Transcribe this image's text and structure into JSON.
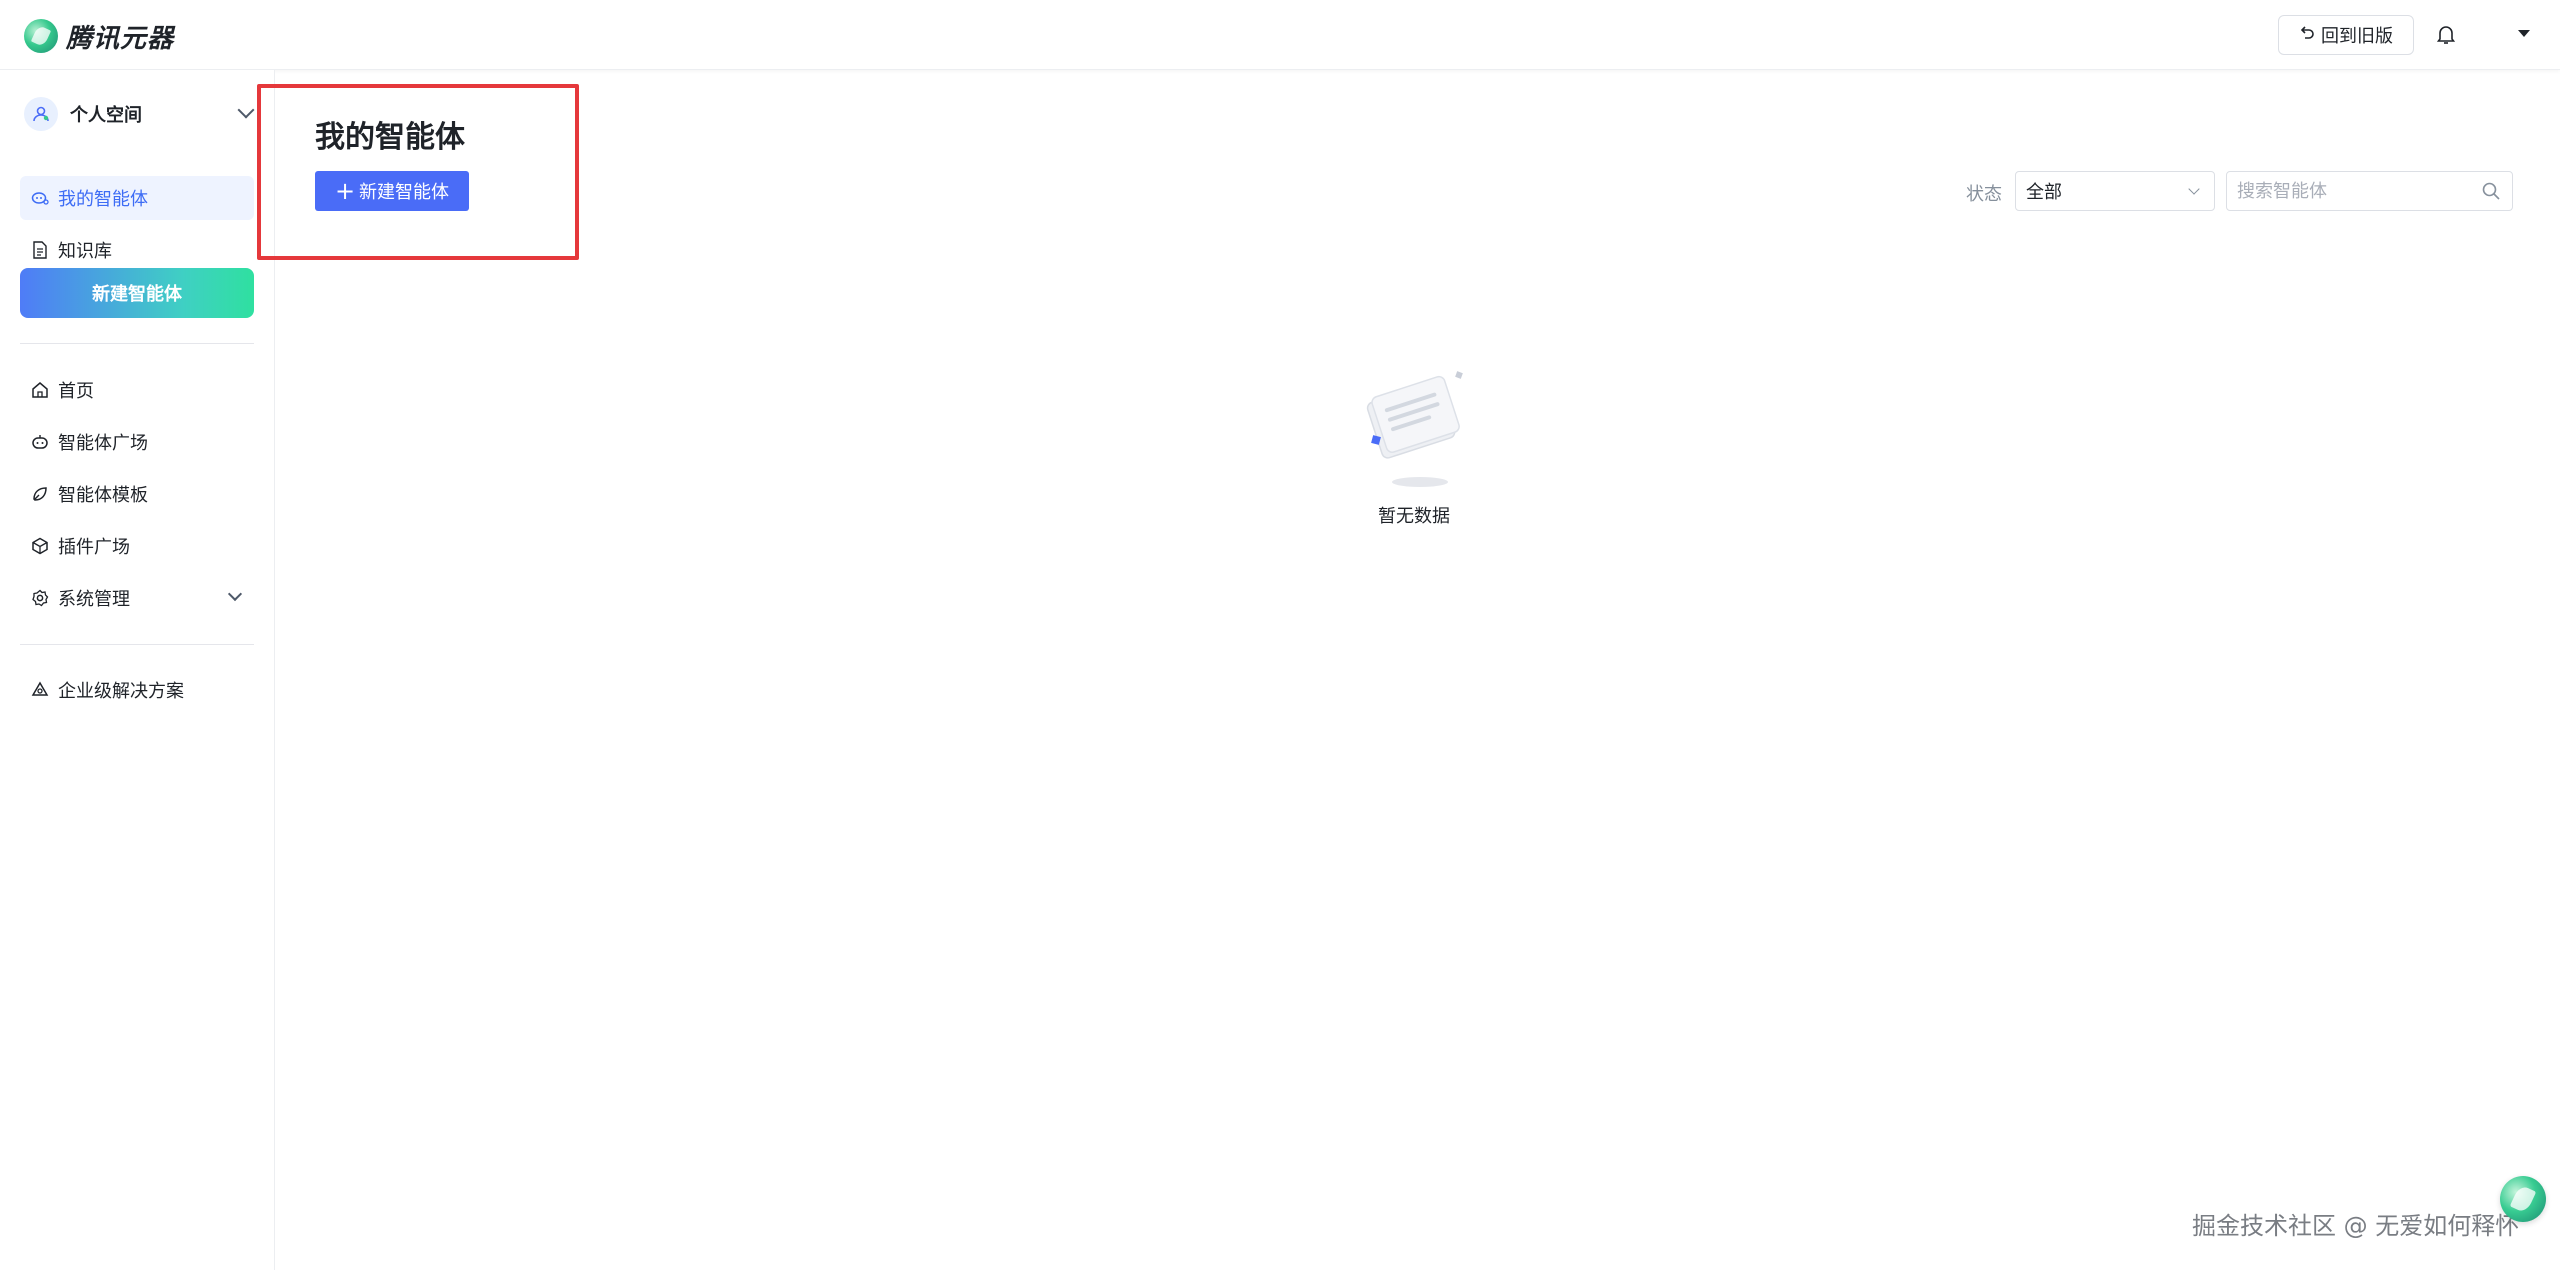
{
  "header": {
    "brand_name": "腾讯元器",
    "back_button_label": "回到旧版"
  },
  "sidebar": {
    "space_label": "个人空间",
    "top_items": [
      {
        "label": "我的智能体",
        "icon": "agent-icon",
        "active": true
      },
      {
        "label": "知识库",
        "icon": "document-icon",
        "active": false
      }
    ],
    "create_button_label": "新建智能体",
    "nav_items": [
      {
        "label": "首页",
        "icon": "home-icon"
      },
      {
        "label": "智能体广场",
        "icon": "robot-icon"
      },
      {
        "label": "智能体模板",
        "icon": "template-icon"
      },
      {
        "label": "插件广场",
        "icon": "cube-icon"
      },
      {
        "label": "系统管理",
        "icon": "gear-icon"
      }
    ],
    "bottom_items": [
      {
        "label": "企业级解决方案",
        "icon": "solution-icon"
      }
    ]
  },
  "main": {
    "title": "我的智能体",
    "create_button_label": "新建智能体",
    "filter": {
      "status_label": "状态",
      "status_value": "全部",
      "search_placeholder": "搜索智能体"
    },
    "empty_text": "暂无数据"
  },
  "watermark": "掘金技术社区 @ 无爱如何释怀",
  "colors": {
    "primary": "#4a6cf7",
    "highlight_border": "#e5383b",
    "active_bg": "#eef3ff",
    "active_text": "#3d6cf5"
  }
}
